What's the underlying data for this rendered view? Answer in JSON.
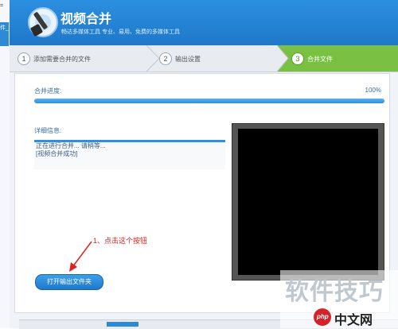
{
  "left_window": {
    "line1": "=",
    "line2": "件_"
  },
  "app": {
    "title": "视频合并",
    "subtitle": "畅达多媒体工具 专业、易用、免费的多媒体工具"
  },
  "steps": [
    {
      "num": "1",
      "label": "添加需要合并的文件"
    },
    {
      "num": "2",
      "label": "输出设置"
    },
    {
      "num": "3",
      "label": "合并文件"
    }
  ],
  "progress": {
    "label": "合并进度:",
    "percent_text": "100%",
    "value": 100
  },
  "detail": {
    "label": "详细信息:",
    "lines": [
      "正在进行合并... 请稍等...",
      "[视频合并成功]"
    ]
  },
  "annotation": {
    "text": "1、点击这个按钮"
  },
  "buttons": {
    "open_folder": "打开输出文件夹"
  },
  "watermark": {
    "text": "软件技巧",
    "logo_text": "php",
    "site_text": "中文网"
  },
  "colors": {
    "accent": "#2c8fe0",
    "active_step": "#7ac043",
    "annotation": "#dd2222"
  },
  "icons": {
    "app_icon": "film-reel-icon",
    "arrow": "red-arrow-icon"
  }
}
